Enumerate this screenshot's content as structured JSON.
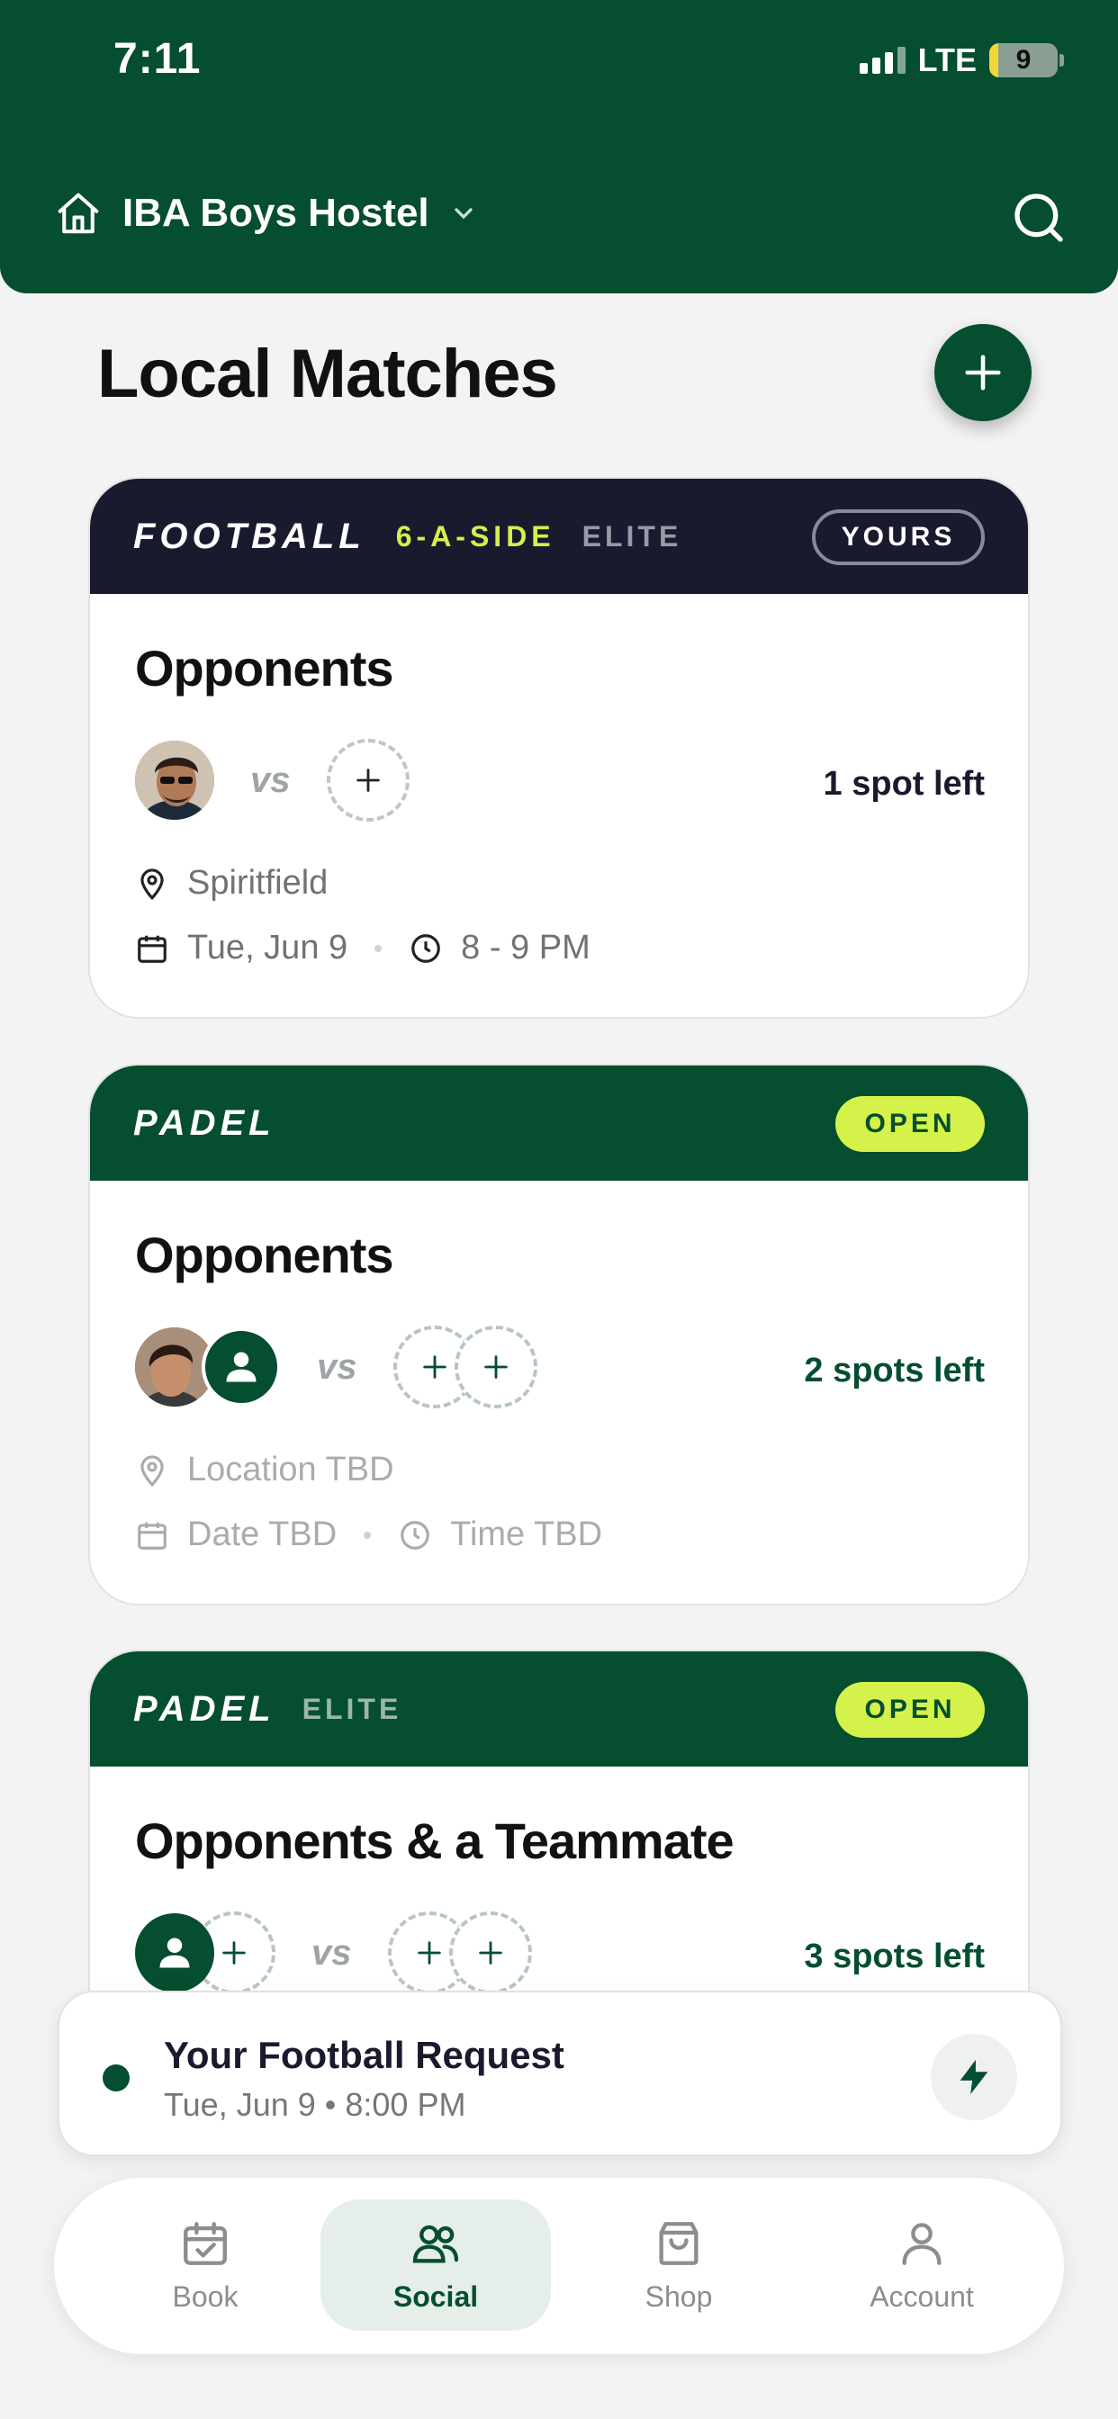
{
  "status_bar": {
    "time": "7:11",
    "network": "LTE",
    "battery": "9"
  },
  "header": {
    "location": "IBA Boys Hostel"
  },
  "page": {
    "title": "Local Matches"
  },
  "matches": [
    {
      "sport": "FOOTBALL",
      "format": "6-A-SIDE",
      "level": "ELITE",
      "badge": "YOURS",
      "heading": "Opponents",
      "vs": "vs",
      "spots": "1 spot left",
      "location": "Spiritfield",
      "date": "Tue, Jun 9",
      "time": "8 - 9 PM"
    },
    {
      "sport": "PADEL",
      "badge": "OPEN",
      "heading": "Opponents",
      "vs": "vs",
      "spots": "2 spots left",
      "location": "Location TBD",
      "date": "Date TBD",
      "time": "Time TBD"
    },
    {
      "sport": "PADEL",
      "level": "ELITE",
      "badge": "OPEN",
      "heading": "Opponents & a Teammate",
      "vs": "vs",
      "spots": "3 spots left"
    }
  ],
  "request": {
    "title": "Your Football Request",
    "subtitle": "Tue, Jun 9 • 8:00 PM"
  },
  "tabs": [
    {
      "label": "Book",
      "icon": "calendar-check-icon"
    },
    {
      "label": "Social",
      "icon": "users-icon",
      "active": true
    },
    {
      "label": "Shop",
      "icon": "shopping-bag-icon"
    },
    {
      "label": "Account",
      "icon": "user-icon"
    }
  ],
  "colors": {
    "brand": "#054e2f",
    "accent": "#d4f24a",
    "dark_header": "#1a1a2e"
  }
}
